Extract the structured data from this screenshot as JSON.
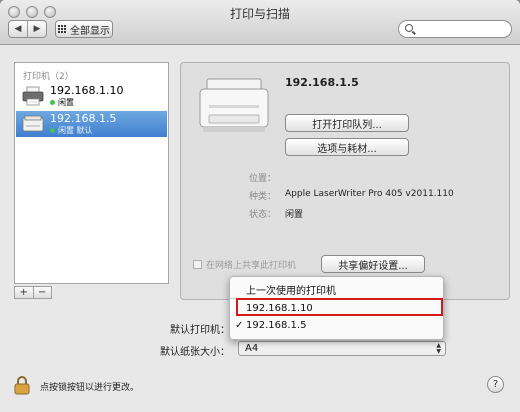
{
  "window": {
    "title": "打印与扫描"
  },
  "toolbar": {
    "back_label": "◀",
    "forward_label": "▶",
    "show_all_label": "全部显示",
    "search_placeholder": ""
  },
  "sidebar": {
    "header": "打印机（2）",
    "items": [
      {
        "name": "192.168.1.10",
        "status": "闲置"
      },
      {
        "name": "192.168.1.5",
        "status": "闲置 默认"
      }
    ],
    "add_label": "+",
    "remove_label": "−"
  },
  "detail": {
    "printer_name": "192.168.1.5",
    "open_queue_label": "打开打印队列...",
    "options_label": "选项与耗材...",
    "location_label": "位置：",
    "location_value": "",
    "kind_label": "种类：",
    "kind_value": "Apple LaserWriter Pro 405 v2011.110",
    "status_label": "状态：",
    "status_value": "闲置",
    "share_label": "在网络上共享此打印机",
    "share_prefs_label": "共享偏好设置..."
  },
  "popup": {
    "items": [
      "上一次使用的打印机",
      "192.168.1.10",
      "192.168.1.5"
    ],
    "checkmark": "✓"
  },
  "defaults": {
    "printer_label": "默认打印机：",
    "paper_label": "默认纸张大小：",
    "paper_value": "A4"
  },
  "footer": {
    "lock_text": "点按锁按钮以进行更改。",
    "help_label": "?"
  },
  "colors": {
    "selection": "#3f7fcf",
    "highlight_box": "#d31a1a"
  }
}
